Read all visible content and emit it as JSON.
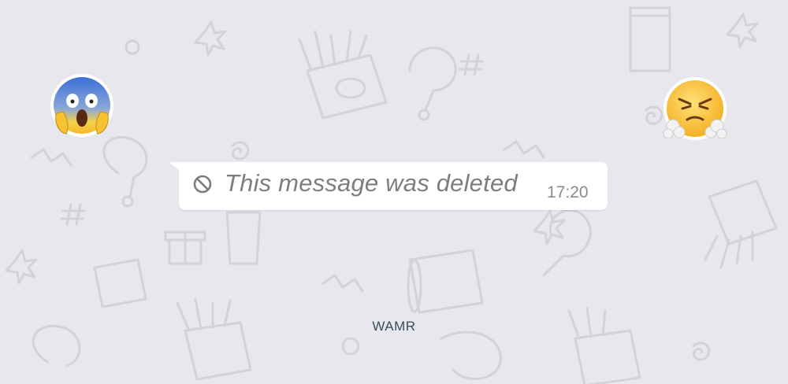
{
  "chat": {
    "message": {
      "text": "This message was deleted",
      "time": "17:20",
      "icon": "blocked-icon"
    },
    "watermark": "WAMR",
    "stickers": {
      "left": "face-screaming-in-fear-emoji",
      "right": "face-with-steam-from-nose-emoji"
    },
    "colors": {
      "wallpaper": "#e8e7ed",
      "bubble": "#ffffff",
      "deleted_text": "#7d7d7d"
    }
  }
}
